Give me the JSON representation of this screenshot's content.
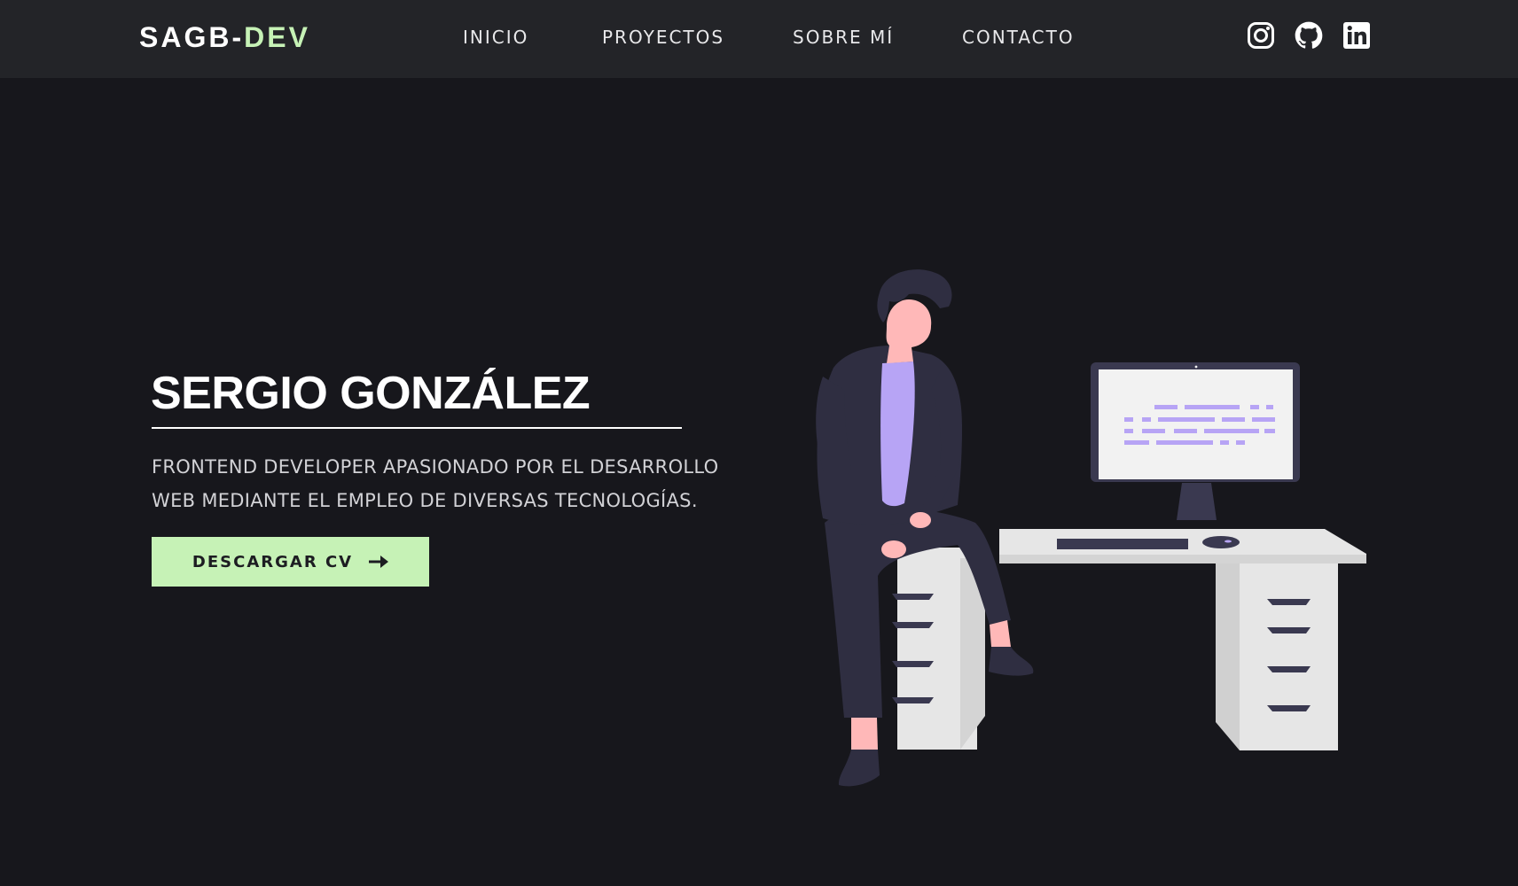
{
  "brand": {
    "prefix": "SAGB-",
    "accent": "DEV"
  },
  "nav": {
    "items": [
      {
        "label": "INICIO"
      },
      {
        "label": "PROYECTOS"
      },
      {
        "label": "SOBRE MÍ"
      },
      {
        "label": "CONTACTO"
      }
    ]
  },
  "social": [
    {
      "icon": "instagram-icon"
    },
    {
      "icon": "github-icon"
    },
    {
      "icon": "linkedin-icon"
    }
  ],
  "hero": {
    "title": "SERGIO GONZÁLEZ",
    "subtitle_line1": "FRONTEND DEVELOPER APASIONADO POR EL DESARROLLO",
    "subtitle_line2": "WEB MEDIANTE EL EMPLEO DE DIVERSAS TECNOLOGÍAS.",
    "button_label": "DESCARGAR CV",
    "button_icon": "arrow-right-icon"
  },
  "colors": {
    "background": "#17171c",
    "navbar": "#232428",
    "accent": "#c6f2b6",
    "illustration_purple": "#b7a4f5",
    "illustration_dark": "#2f2e41"
  }
}
